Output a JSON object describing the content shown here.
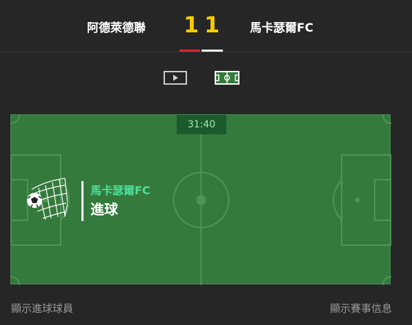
{
  "match": {
    "home_team": "阿德萊德聯",
    "away_team": "馬卡瑟爾FC",
    "home_score": "1",
    "away_score": "1"
  },
  "colors": {
    "home_accent": "#e0262e",
    "away_accent": "#ffffff",
    "score": "#f5cc00",
    "pitch": "#357a3d"
  },
  "view_toggle": {
    "video_icon": "play-video-icon",
    "pitch_icon": "pitch-view-icon",
    "active": "pitch"
  },
  "live": {
    "clock": "31:40",
    "event_team": "馬卡瑟爾FC",
    "event_type": "進球",
    "event_icon": "soccer-ball-net-icon"
  },
  "footer": {
    "show_scorers": "顯示進球球員",
    "show_match_info": "顯示賽事信息"
  }
}
